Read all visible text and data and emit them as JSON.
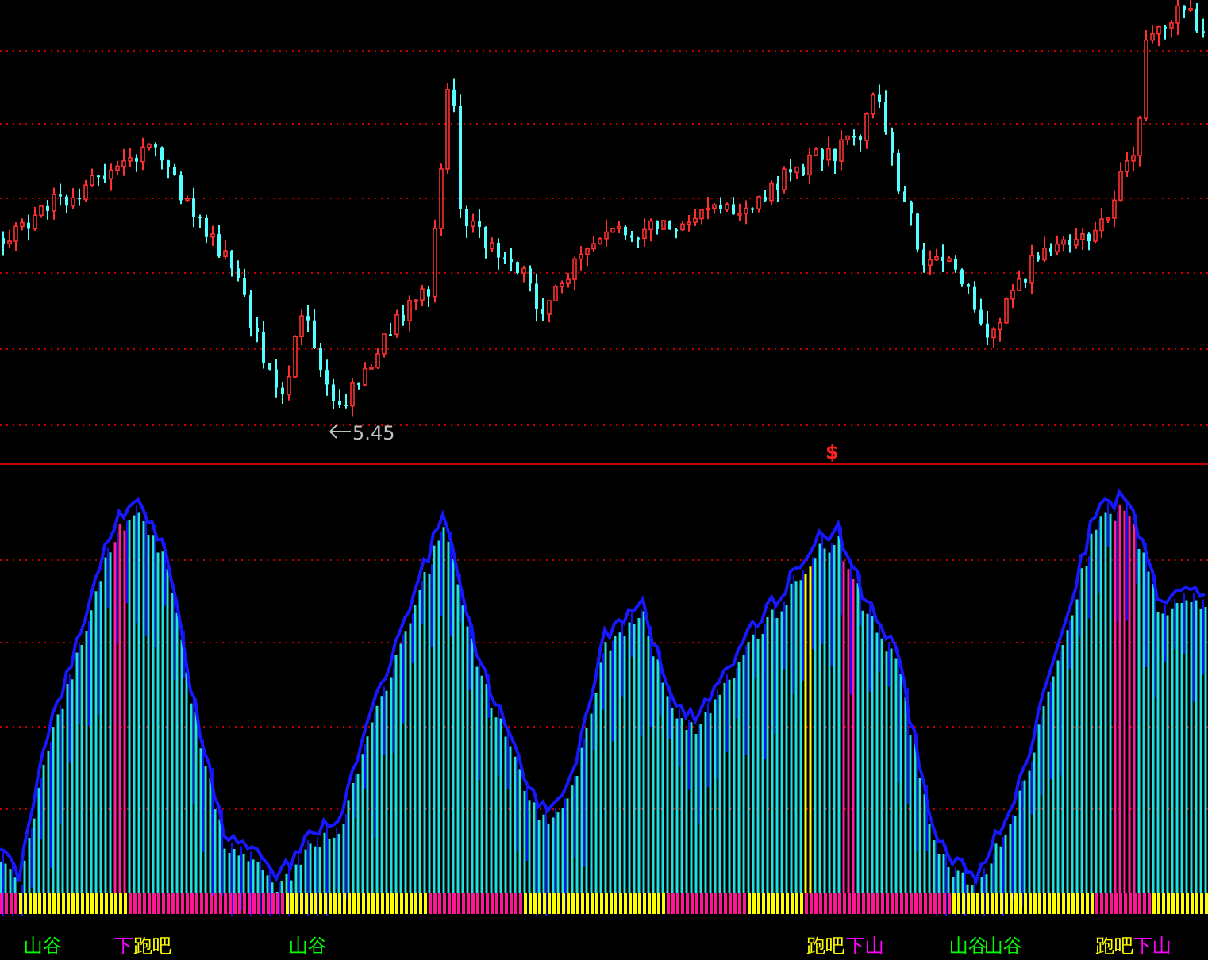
{
  "price_panel": {
    "low_label": "5.45"
  },
  "signal_marker": "$",
  "signals": [
    {
      "text": "山谷",
      "color": "#00ff00"
    },
    {
      "text": "下",
      "color": "#ff00ff"
    },
    {
      "text": "跑吧",
      "color": "#ffff00"
    },
    {
      "text": "山谷",
      "color": "#00ff00"
    },
    {
      "text": "跑吧",
      "color": "#ffff00"
    },
    {
      "text": "下山",
      "color": "#ff00ff"
    },
    {
      "text": "山谷",
      "color": "#00ff00"
    },
    {
      "text": "山谷",
      "color": "#00ff00"
    },
    {
      "text": "跑吧",
      "color": "#ffff00"
    },
    {
      "text": "下山",
      "color": "#ff00ff"
    }
  ]
}
